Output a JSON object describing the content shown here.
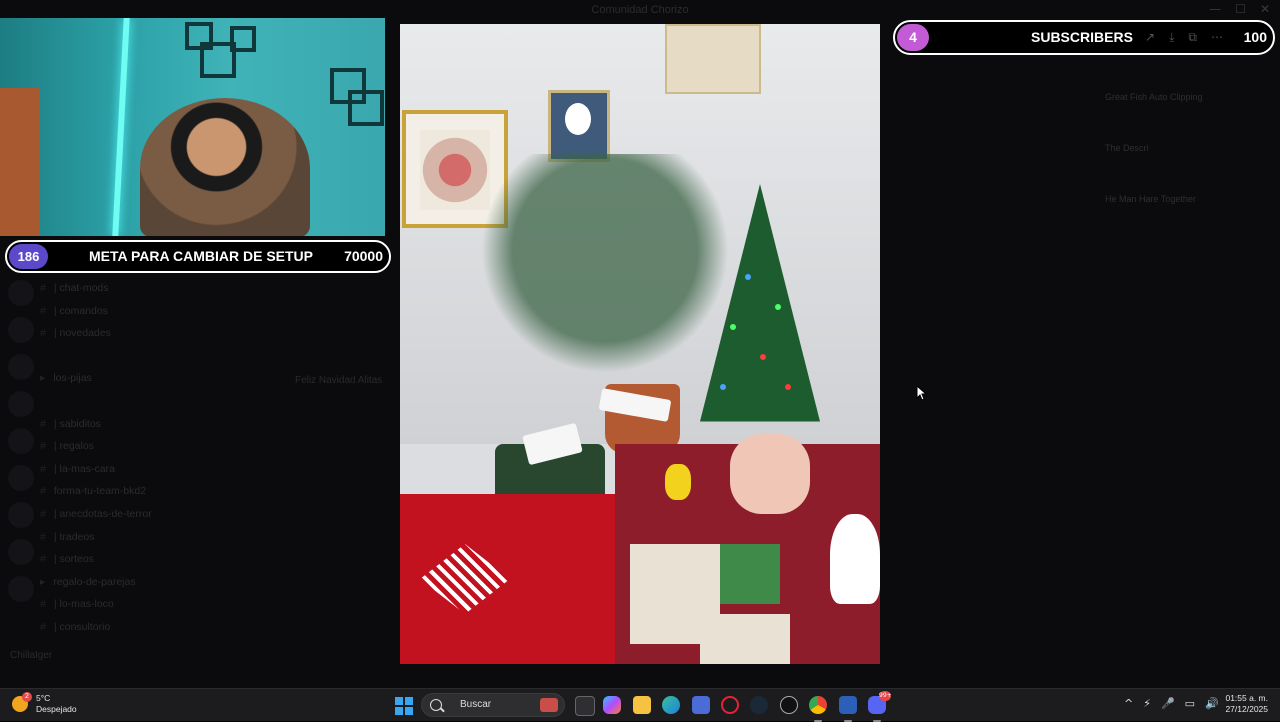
{
  "background_app": {
    "window_title": "Comunidad Chorizo",
    "window_controls": [
      "—",
      "☐",
      "✕"
    ],
    "channels": [
      "| chat-mods",
      "| comandos",
      "| novedades",
      "",
      "los-pijas",
      "",
      "| sabiditos",
      "| regalos",
      "| la-mas-cara",
      "forma-tu-team-bkd2",
      "| anecdotas-de-terror",
      "| tradeos",
      "| sorteos",
      "regalo-de-parejas",
      "| lo-mas-loco",
      "| consultorio"
    ],
    "chat_message": "Feliz Navidad Alitas",
    "user_name": "ChillaIger",
    "right_list": [
      {
        "title": "Great Fish Auto Clipping",
        "sub": ""
      },
      {
        "title": "The Descri",
        "sub": ""
      },
      {
        "title": "He Man Hare Together",
        "sub": ""
      }
    ]
  },
  "goal_widget": {
    "count": "186",
    "label": "META PARA CAMBIAR DE SETUP",
    "target": "70000"
  },
  "subscribers_widget": {
    "count": "4",
    "label": "SUBSCRIBERS",
    "target": "100",
    "ghost_icons": [
      "↗",
      "⤓",
      "⧉",
      "⋯"
    ]
  },
  "taskbar": {
    "weather_temp": "5°C",
    "weather_desc": "Despejado",
    "weather_badge": "2",
    "search_placeholder": "Buscar",
    "discord_badge": "99+",
    "time": "01:55 a. m.",
    "date": "27/12/2025",
    "tray_icons": [
      "^",
      "⚡",
      "🎤",
      "▭",
      "🔊"
    ]
  },
  "colors": {
    "goal_count_bg": "#5b49c9",
    "subs_count_bg": "#c45bd6",
    "taskbar_bg": "#1c1c1e",
    "windows_blue": "#38a6f0"
  }
}
